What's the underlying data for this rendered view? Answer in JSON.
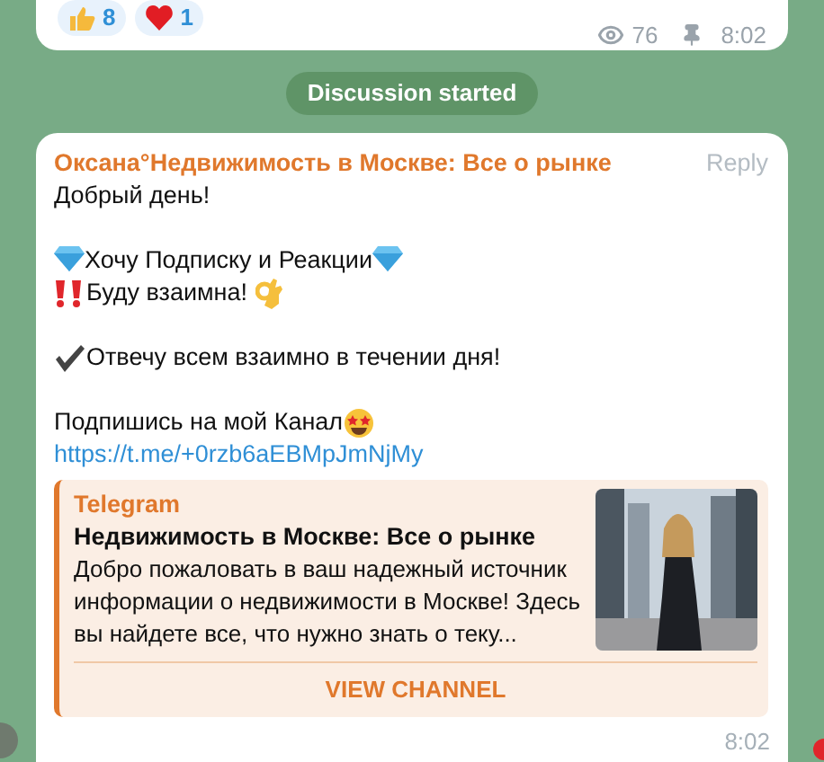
{
  "post_footer": {
    "reactions": [
      {
        "kind": "thumbs",
        "count": "8"
      },
      {
        "kind": "heart",
        "count": "1"
      }
    ],
    "views": "76",
    "time": "8:02"
  },
  "service_message": "Discussion started",
  "comment": {
    "author": "Оксана°Недвижимость в Москве: Все о рынке",
    "reply": "Reply",
    "paragraphs": [
      [
        {
          "kind": "plain",
          "text": "Добрый день!"
        }
      ],
      [
        {
          "kind": "diamonds",
          "text": "Хочу Подписку и Реакции"
        },
        {
          "kind": "exclaim",
          "text": "Буду взаимна!"
        }
      ],
      [
        {
          "kind": "check",
          "text": "Отвечу всем взаимно в течении дня!"
        }
      ],
      [
        {
          "kind": "starstruck",
          "text": "Подпишись на мой Канал"
        },
        {
          "kind": "link",
          "text": "https://t.me/+0rzb6aEBMpJmNjMy"
        }
      ]
    ],
    "preview": {
      "site": "Telegram",
      "title": "Недвижимость в Москве: Все о рынке",
      "description": "Добро пожаловать в ваш надежный источник информации о недвижимости в Москве! Здесь вы найдете все, что нужно знать о теку...",
      "button": "VIEW CHANNEL"
    },
    "time": "8:02"
  }
}
